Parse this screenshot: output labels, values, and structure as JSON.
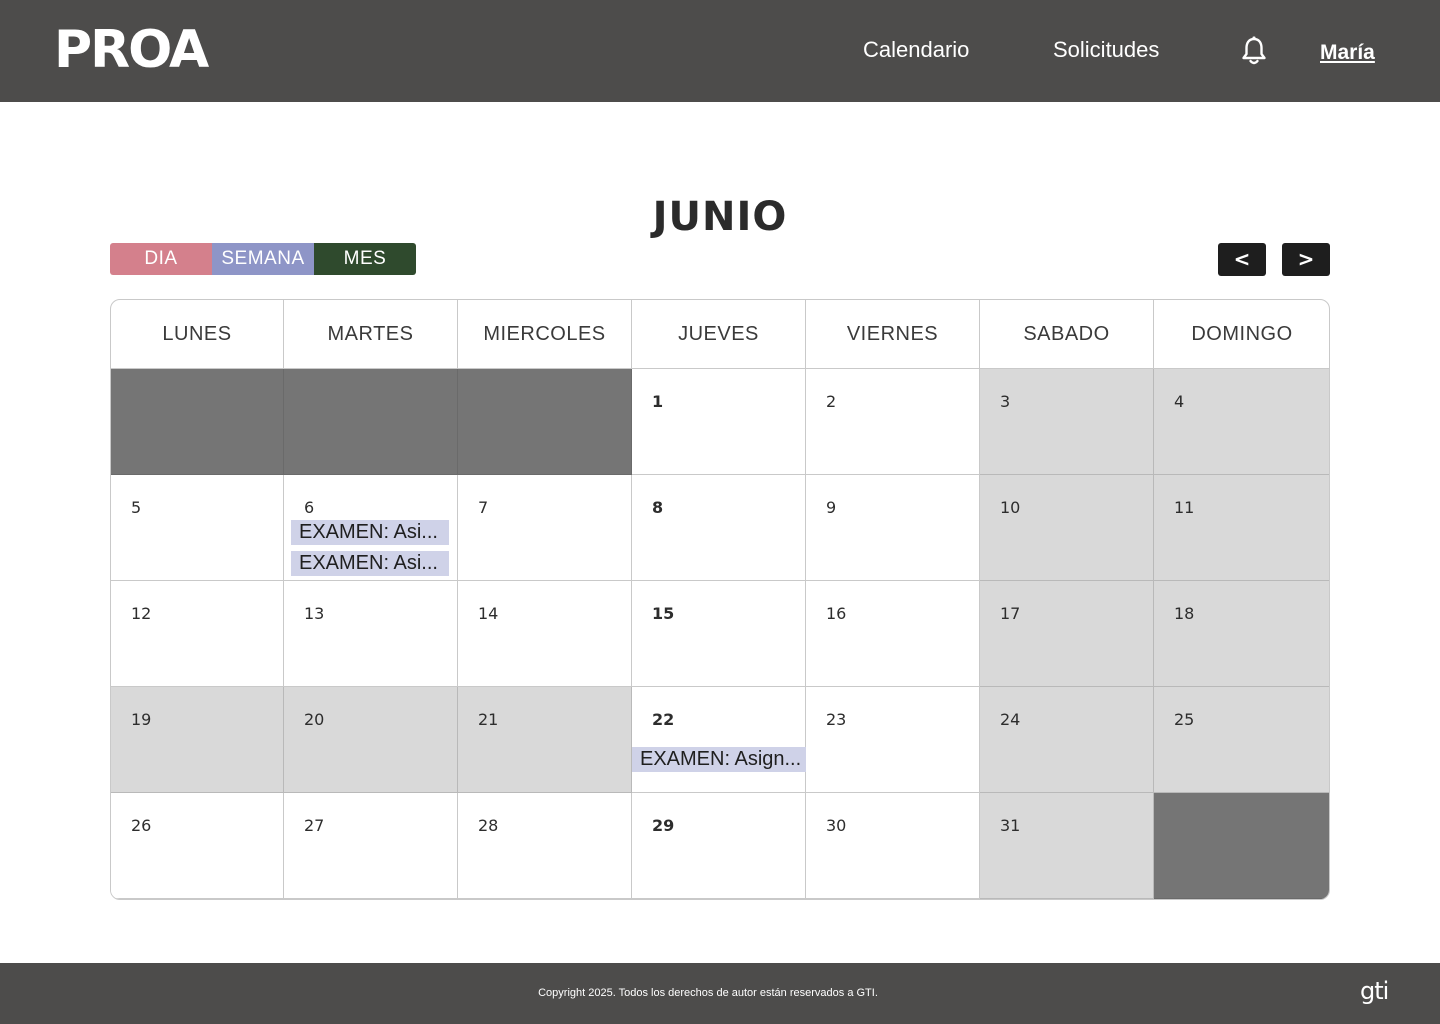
{
  "header": {
    "logo_text": "PROA",
    "nav": [
      "Calendario",
      "Solicitudes"
    ],
    "notification_icon": "bell-icon",
    "user_name": "María"
  },
  "calendar": {
    "month_title": "JUNIO",
    "view_buttons": [
      "DIA",
      "SEMANA",
      "MES"
    ],
    "prev_label": "<",
    "next_label": ">",
    "weekdays": [
      "LUNES",
      "MARTES",
      "MIERCOLES",
      "JUEVES",
      "VIERNES",
      "SABADO",
      "DOMINGO"
    ],
    "weeks": [
      [
        null,
        null,
        null,
        "1",
        "2",
        "3",
        "4"
      ],
      [
        "5",
        "6",
        "7",
        "8",
        "9",
        "10",
        "11"
      ],
      [
        "12",
        "13",
        "14",
        "15",
        "16",
        "17",
        "18"
      ],
      [
        "19",
        "20",
        "21",
        "22",
        "23",
        "24",
        "25"
      ],
      [
        "26",
        "27",
        "28",
        "29",
        "30",
        "31",
        null
      ]
    ],
    "events": {
      "6": [
        "EXAMEN: Asi...",
        "EXAMEN: Asi..."
      ],
      "22": [
        "EXAMEN: Asign..."
      ]
    }
  },
  "footer": {
    "copyright": "Copyright 2025. Todos los derechos de autor están reservados a GTI.",
    "brand": "gti"
  },
  "colors": {
    "header_bg": "#4d4c4b",
    "dia": "#d4808c",
    "semana": "#8e95c7",
    "mes": "#2f4a2d",
    "event_bg": "#cfd2e8",
    "cell_light": "#d9d9d9",
    "cell_dark": "#757575"
  }
}
